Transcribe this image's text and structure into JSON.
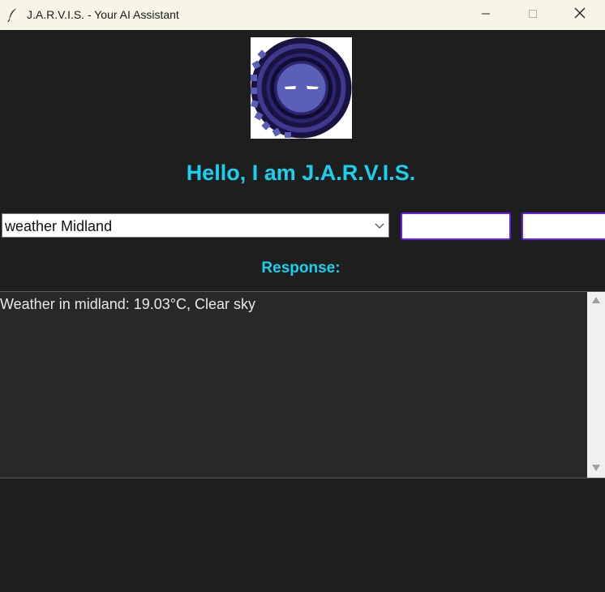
{
  "window": {
    "title": "J.A.R.V.I.S. - Your AI Assistant"
  },
  "icons": {
    "app": "feather-icon",
    "minimize": "minimize-icon",
    "maximize": "maximize-icon",
    "close": "close-icon",
    "dropdown": "chevron-down-icon",
    "scroll_up": "triangle-up-icon",
    "scroll_down": "triangle-down-icon",
    "logo": "jarvis-robot-logo"
  },
  "main": {
    "greeting": "Hello, I am J.A.R.V.I.S.",
    "command_value": "weather Midland",
    "response_label": "Response:",
    "response_text": "Weather in midland: 19.03°C, Clear sky"
  },
  "colors": {
    "background": "#1e1e1e",
    "accent": "#1ad0f0",
    "button_border": "#6b1fe8",
    "textarea_bg": "#282828",
    "titlebar_bg": "#f7f5e6"
  }
}
